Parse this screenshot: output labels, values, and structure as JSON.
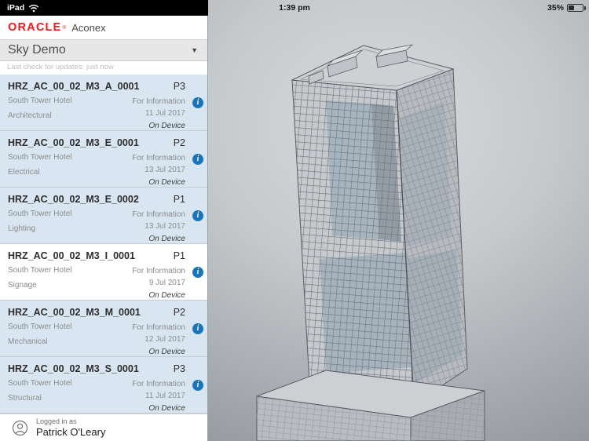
{
  "colors": {
    "oracle_red": "#ed1c1c",
    "info_blue": "#1a74ba",
    "row_blue": "#d9e6f2",
    "status_black": "#000000"
  },
  "status_bar": {
    "device": "iPad",
    "time": "1:39 pm",
    "battery_percent": "35%"
  },
  "icons": {
    "info_glyph": "i",
    "chevron_down": "▼"
  },
  "sidebar": {
    "logo": {
      "brand": "ORACLE",
      "registered": "®",
      "product": "Aconex"
    },
    "project_selector": {
      "value": "Sky Demo"
    },
    "update_status": "Last check for updates: just now",
    "documents": [
      {
        "id": "HRZ_AC_00_02_M3_A_0001",
        "revision": "P3",
        "location": "South Tower Hotel",
        "status": "For Information",
        "discipline": "Architectural",
        "date": "11 Jul 2017",
        "device": "On Device"
      },
      {
        "id": "HRZ_AC_00_02_M3_E_0001",
        "revision": "P2",
        "location": "South Tower Hotel",
        "status": "For Information",
        "discipline": "Electrical",
        "date": "13 Jul 2017",
        "device": "On Device"
      },
      {
        "id": "HRZ_AC_00_02_M3_E_0002",
        "revision": "P1",
        "location": "South Tower Hotel",
        "status": "For Information",
        "discipline": "Lighting",
        "date": "13 Jul 2017",
        "device": "On Device"
      },
      {
        "id": "HRZ_AC_00_02_M3_I_0001",
        "revision": "P1",
        "location": "South Tower Hotel",
        "status": "For Information",
        "discipline": "Signage",
        "date": "9 Jul 2017",
        "device": "On Device"
      },
      {
        "id": "HRZ_AC_00_02_M3_M_0001",
        "revision": "P2",
        "location": "South Tower Hotel",
        "status": "For Information",
        "discipline": "Mechanical",
        "date": "12 Jul 2017",
        "device": "On Device"
      },
      {
        "id": "HRZ_AC_00_02_M3_S_0001",
        "revision": "P3",
        "location": "South Tower Hotel",
        "status": "For Information",
        "discipline": "Structural",
        "date": "11 Jul 2017",
        "device": "On Device"
      }
    ],
    "footer": {
      "prefix": "Logged in as",
      "user": "Patrick O'Leary"
    }
  }
}
